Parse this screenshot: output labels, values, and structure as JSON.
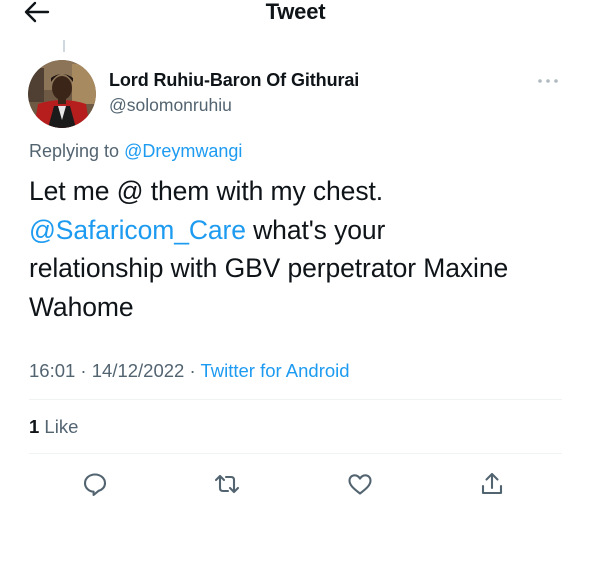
{
  "header": {
    "title": "Tweet",
    "back_icon": "arrow-left-icon"
  },
  "author": {
    "display_name": "Lord Ruhiu-Baron Of Githurai",
    "handle": "@solomonruhiu"
  },
  "reply": {
    "prefix": "Replying to ",
    "mention": "@Dreymwangi"
  },
  "tweet": {
    "line1": "Let me @ them with my chest.",
    "mention": "@Safaricom_Care",
    "after_mention": " what's your",
    "line3": "relationship with GBV perpetrator Maxine",
    "line4": "Wahome"
  },
  "meta": {
    "time": "16:01",
    "sep1": " · ",
    "date": "14/12/2022",
    "sep2": " · ",
    "source": "Twitter for Android"
  },
  "stats": {
    "like_count": "1",
    "like_label": " Like"
  },
  "actions": [
    {
      "icon": "reply-icon"
    },
    {
      "icon": "retweet-icon"
    },
    {
      "icon": "like-icon"
    },
    {
      "icon": "share-icon"
    }
  ],
  "colors": {
    "accent": "#1d9bf0",
    "secondary_text": "#536471",
    "primary_text": "#0f1419",
    "divider": "#eff3f4"
  }
}
